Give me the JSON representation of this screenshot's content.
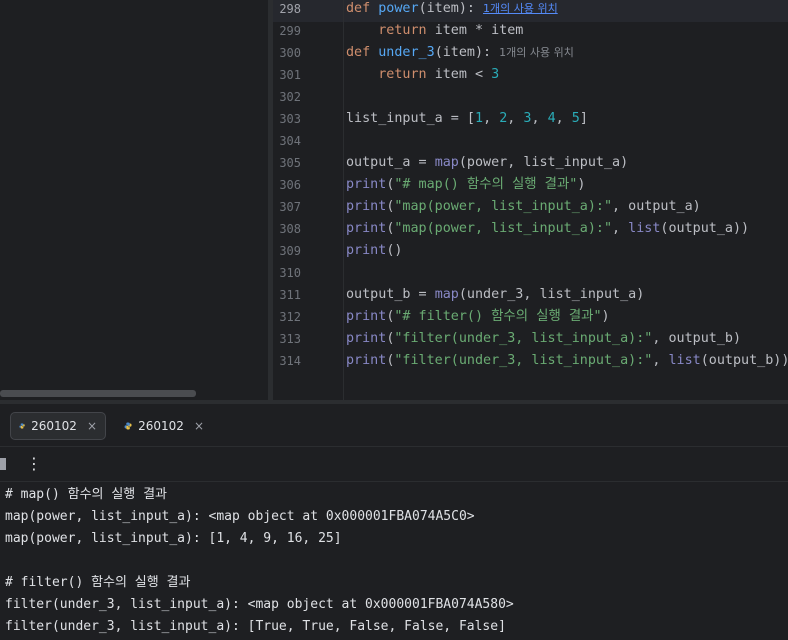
{
  "editor": {
    "lines": [
      {
        "n": "298",
        "tokens": [
          [
            "kw",
            "def "
          ],
          [
            "fn",
            "power"
          ],
          [
            "t",
            "(item):"
          ]
        ],
        "hint": "1개의 사용 위치",
        "hint_link": true
      },
      {
        "n": "299",
        "tokens": [
          [
            "t",
            "    "
          ],
          [
            "kw",
            "return "
          ],
          [
            "t",
            "item * item"
          ]
        ]
      },
      {
        "n": "300",
        "tokens": [
          [
            "kw",
            "def "
          ],
          [
            "fn",
            "under_3"
          ],
          [
            "t",
            "(item):"
          ]
        ],
        "hint": "1개의 사용 위치",
        "hint_link": false
      },
      {
        "n": "301",
        "tokens": [
          [
            "t",
            "    "
          ],
          [
            "kw",
            "return "
          ],
          [
            "t",
            "item < "
          ],
          [
            "num",
            "3"
          ]
        ]
      },
      {
        "n": "302",
        "tokens": []
      },
      {
        "n": "303",
        "tokens": [
          [
            "t",
            "list_input_a = ["
          ],
          [
            "num",
            "1"
          ],
          [
            "t",
            ", "
          ],
          [
            "num",
            "2"
          ],
          [
            "t",
            ", "
          ],
          [
            "num",
            "3"
          ],
          [
            "t",
            ", "
          ],
          [
            "num",
            "4"
          ],
          [
            "t",
            ", "
          ],
          [
            "num",
            "5"
          ],
          [
            "t",
            "]"
          ]
        ]
      },
      {
        "n": "304",
        "tokens": []
      },
      {
        "n": "305",
        "tokens": [
          [
            "t",
            "output_a = "
          ],
          [
            "bi",
            "map"
          ],
          [
            "t",
            "(power, list_input_a)"
          ]
        ]
      },
      {
        "n": "306",
        "tokens": [
          [
            "bi",
            "print"
          ],
          [
            "t",
            "("
          ],
          [
            "str",
            "\"# map() 함수의 실행 결과\""
          ],
          [
            "t",
            ")"
          ]
        ]
      },
      {
        "n": "307",
        "tokens": [
          [
            "bi",
            "print"
          ],
          [
            "t",
            "("
          ],
          [
            "str",
            "\"map(power, list_input_a):\""
          ],
          [
            "t",
            ", output_a)"
          ]
        ]
      },
      {
        "n": "308",
        "tokens": [
          [
            "bi",
            "print"
          ],
          [
            "t",
            "("
          ],
          [
            "str",
            "\"map(power, list_input_a):\""
          ],
          [
            "t",
            ", "
          ],
          [
            "bi",
            "list"
          ],
          [
            "t",
            "(output_a))"
          ]
        ]
      },
      {
        "n": "309",
        "tokens": [
          [
            "bi",
            "print"
          ],
          [
            "t",
            "()"
          ]
        ]
      },
      {
        "n": "310",
        "tokens": []
      },
      {
        "n": "311",
        "tokens": [
          [
            "t",
            "output_b = "
          ],
          [
            "bi",
            "map"
          ],
          [
            "t",
            "(under_3, list_input_a)"
          ]
        ]
      },
      {
        "n": "312",
        "tokens": [
          [
            "bi",
            "print"
          ],
          [
            "t",
            "("
          ],
          [
            "str",
            "\"# filter() 함수의 실행 결과\""
          ],
          [
            "t",
            ")"
          ]
        ]
      },
      {
        "n": "313",
        "tokens": [
          [
            "bi",
            "print"
          ],
          [
            "t",
            "("
          ],
          [
            "str",
            "\"filter(under_3, list_input_a):\""
          ],
          [
            "t",
            ", output_b)"
          ]
        ]
      },
      {
        "n": "314",
        "tokens": [
          [
            "bi",
            "print"
          ],
          [
            "t",
            "("
          ],
          [
            "str",
            "\"filter(under_3, list_input_a):\""
          ],
          [
            "t",
            ", "
          ],
          [
            "bi",
            "list"
          ],
          [
            "t",
            "(output_b))"
          ]
        ]
      }
    ],
    "current_line": "298"
  },
  "run_tabs": [
    {
      "label": "260102",
      "active": true
    },
    {
      "label": "260102",
      "active": false
    }
  ],
  "tab_close_glyph": "×",
  "toolbar": {
    "more_glyph": "⋮"
  },
  "console_lines": [
    "# map() 함수의 실행 결과",
    "map(power, list_input_a): <map object at 0x000001FBA074A5C0>",
    "map(power, list_input_a): [1, 4, 9, 16, 25]",
    "",
    "# filter() 함수의 실행 결과",
    "filter(under_3, list_input_a): <map object at 0x000001FBA074A580>",
    "filter(under_3, list_input_a): [True, True, False, False, False]"
  ],
  "colors": {
    "keyword": "#cf8e6d",
    "function": "#56a8f5",
    "builtin": "#8888c6",
    "string": "#6aab73",
    "number": "#2aacb8",
    "background": "#1e1f22"
  }
}
